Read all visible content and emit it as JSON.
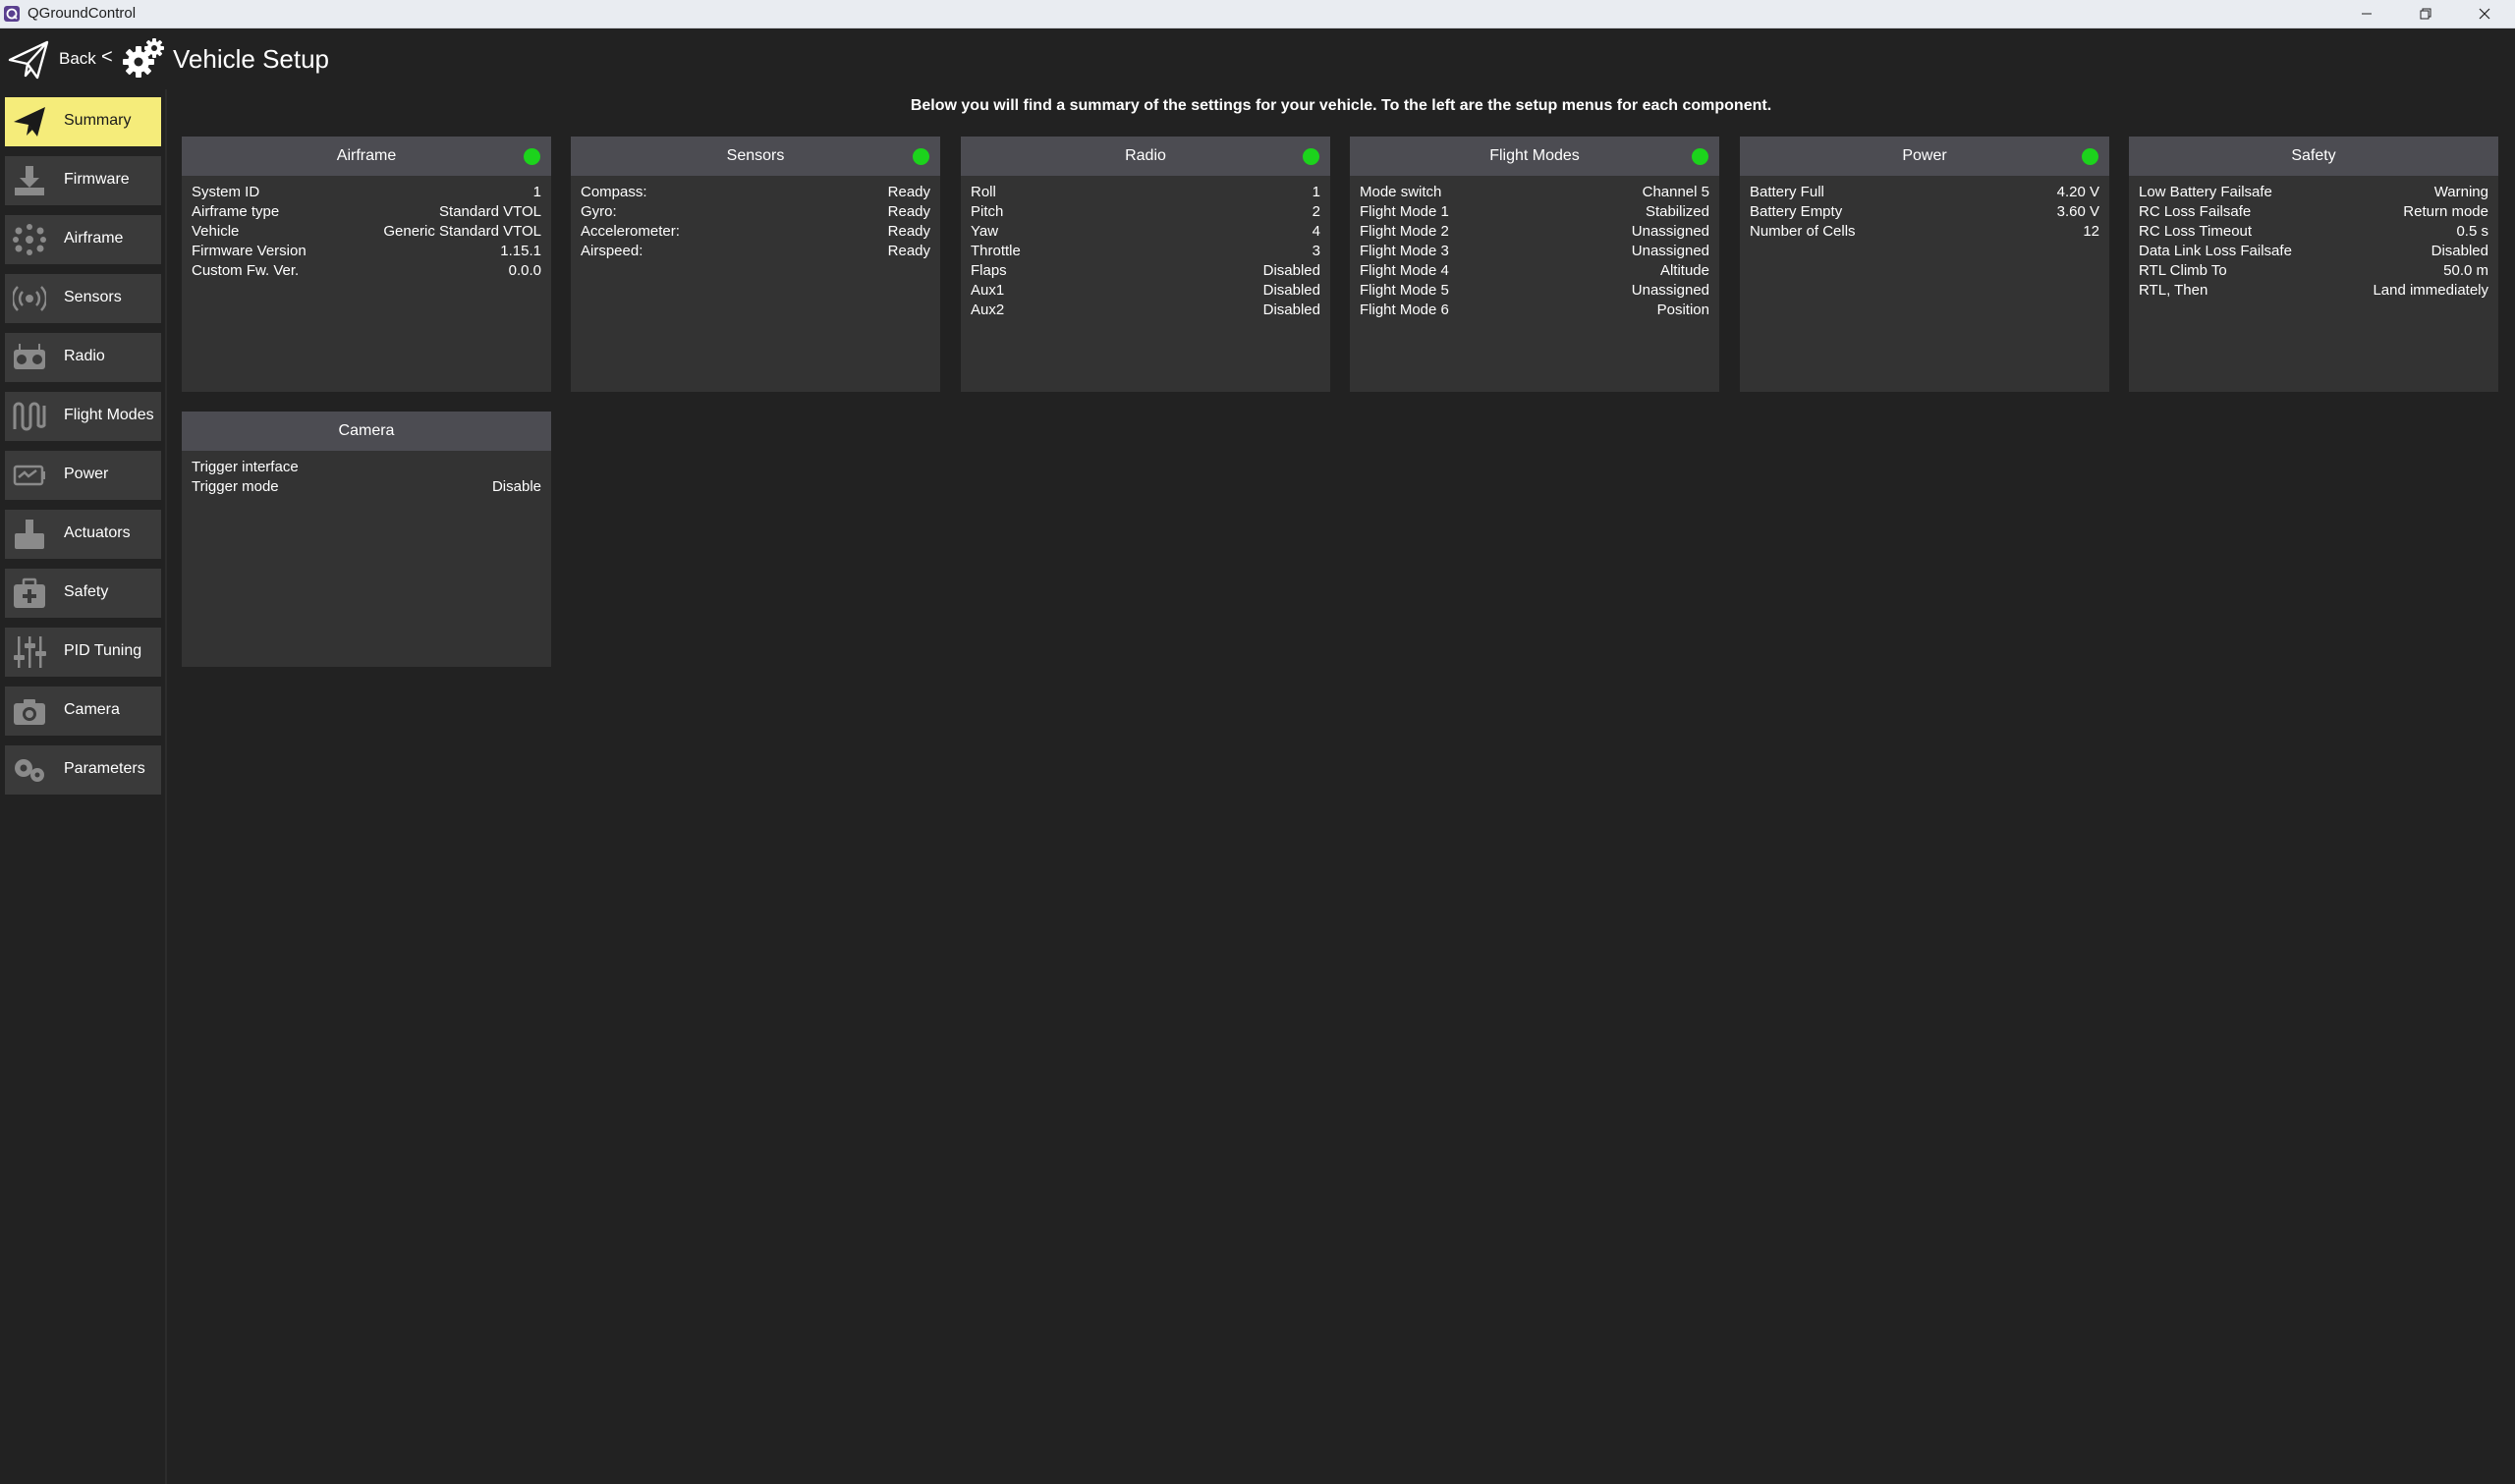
{
  "window": {
    "title": "QGroundControl"
  },
  "toolbar": {
    "back_label": "Back",
    "separator": "<",
    "page_title": "Vehicle Setup"
  },
  "sidebar": {
    "items": [
      {
        "label": "Summary",
        "icon": "paper-plane-icon",
        "active": true
      },
      {
        "label": "Firmware",
        "icon": "download-icon"
      },
      {
        "label": "Airframe",
        "icon": "airframe-icon"
      },
      {
        "label": "Sensors",
        "icon": "sensors-icon"
      },
      {
        "label": "Radio",
        "icon": "radio-icon"
      },
      {
        "label": "Flight Modes",
        "icon": "flight-modes-icon"
      },
      {
        "label": "Power",
        "icon": "power-icon"
      },
      {
        "label": "Actuators",
        "icon": "actuators-icon"
      },
      {
        "label": "Safety",
        "icon": "safety-icon"
      },
      {
        "label": "PID Tuning",
        "icon": "sliders-icon"
      },
      {
        "label": "Camera",
        "icon": "camera-icon"
      },
      {
        "label": "Parameters",
        "icon": "gears-icon"
      }
    ]
  },
  "main": {
    "intro": "Below you will find a summary of the settings for your vehicle. To the left are the setup menus for each component.",
    "cards": [
      {
        "title": "Airframe",
        "status": "ok",
        "rows": [
          {
            "label": "System ID",
            "value": "1"
          },
          {
            "label": "Airframe type",
            "value": "Standard VTOL"
          },
          {
            "label": "Vehicle",
            "value": "Generic Standard VTOL"
          },
          {
            "label": "Firmware Version",
            "value": "1.15.1"
          },
          {
            "label": "Custom Fw. Ver.",
            "value": "0.0.0"
          }
        ]
      },
      {
        "title": "Sensors",
        "status": "ok",
        "rows": [
          {
            "label": "Compass:",
            "value": "Ready"
          },
          {
            "label": "Gyro:",
            "value": "Ready"
          },
          {
            "label": "Accelerometer:",
            "value": "Ready"
          },
          {
            "label": "Airspeed:",
            "value": "Ready"
          }
        ]
      },
      {
        "title": "Radio",
        "status": "ok",
        "rows": [
          {
            "label": "Roll",
            "value": "1"
          },
          {
            "label": "Pitch",
            "value": "2"
          },
          {
            "label": "Yaw",
            "value": "4"
          },
          {
            "label": "Throttle",
            "value": "3"
          },
          {
            "label": "Flaps",
            "value": "Disabled"
          },
          {
            "label": "Aux1",
            "value": "Disabled"
          },
          {
            "label": "Aux2",
            "value": "Disabled"
          }
        ]
      },
      {
        "title": "Flight Modes",
        "status": "ok",
        "rows": [
          {
            "label": "Mode switch",
            "value": "Channel 5"
          },
          {
            "label": "Flight Mode 1",
            "value": "Stabilized"
          },
          {
            "label": "Flight Mode 2",
            "value": "Unassigned"
          },
          {
            "label": "Flight Mode 3",
            "value": "Unassigned"
          },
          {
            "label": "Flight Mode 4",
            "value": "Altitude"
          },
          {
            "label": "Flight Mode 5",
            "value": "Unassigned"
          },
          {
            "label": "Flight Mode 6",
            "value": "Position"
          }
        ]
      },
      {
        "title": "Power",
        "status": "ok",
        "rows": [
          {
            "label": "Battery Full",
            "value": "4.20 V"
          },
          {
            "label": "Battery Empty",
            "value": "3.60 V"
          },
          {
            "label": "Number of Cells",
            "value": "12"
          }
        ]
      },
      {
        "title": "Safety",
        "status": "none",
        "rows": [
          {
            "label": "Low Battery Failsafe",
            "value": "Warning"
          },
          {
            "label": "RC Loss Failsafe",
            "value": "Return mode"
          },
          {
            "label": "RC Loss Timeout",
            "value": "0.5 s"
          },
          {
            "label": "Data Link Loss Failsafe",
            "value": "Disabled"
          },
          {
            "label": "RTL Climb To",
            "value": "50.0 m"
          },
          {
            "label": "RTL, Then",
            "value": "Land immediately"
          }
        ]
      },
      {
        "title": "Camera",
        "status": "none",
        "rows": [
          {
            "label": "Trigger interface",
            "value": ""
          },
          {
            "label": "Trigger mode",
            "value": "Disable"
          }
        ]
      }
    ]
  },
  "colors": {
    "background": "#222222",
    "card": "#333333",
    "card_header": "#4c4c52",
    "nav_item": "#3a3a3a",
    "nav_active": "#f5ec7a",
    "status_ok": "#1cd31c"
  }
}
